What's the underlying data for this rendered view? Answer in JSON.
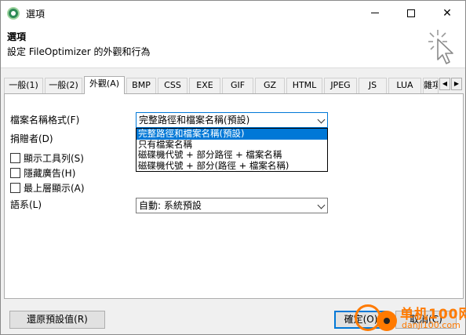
{
  "window": {
    "title": "選項",
    "icon": "fileoptimizer-app-icon",
    "controls": [
      "minimize-icon",
      "maximize-icon",
      "close-icon"
    ],
    "close_glyph": "✕"
  },
  "header": {
    "title": "選項",
    "description": "設定 FileOptimizer 的外觀和行為",
    "icon": "cursor-click-icon"
  },
  "tabs": [
    {
      "label": "一般(1)",
      "active": false
    },
    {
      "label": "一般(2)",
      "active": false
    },
    {
      "label": "外觀(A)",
      "active": true
    },
    {
      "label": "BMP",
      "active": false
    },
    {
      "label": "CSS",
      "active": false
    },
    {
      "label": "EXE",
      "active": false
    },
    {
      "label": "GIF",
      "active": false
    },
    {
      "label": "GZ",
      "active": false
    },
    {
      "label": "HTML",
      "active": false
    },
    {
      "label": "JPEG",
      "active": false
    },
    {
      "label": "JS",
      "active": false
    },
    {
      "label": "LUA",
      "active": false
    },
    {
      "label": "雜項",
      "active": false
    }
  ],
  "tab_scroll": {
    "left": "◀",
    "right": "▶"
  },
  "appearance": {
    "filename_format_label": "檔案名稱格式(F)",
    "filename_format_value": "完整路徑和檔案名稱(預設)",
    "filename_format_options": [
      "完整路徑和檔案名稱(預設)",
      "只有檔案名稱",
      "磁碟機代號 + 部分路徑 + 檔案名稱",
      "磁碟機代號 + 部分(路徑 + 檔案名稱)"
    ],
    "donator_label": "捐贈者(D)",
    "checkboxes": [
      {
        "label": "顯示工具列(S)",
        "checked": false
      },
      {
        "label": "隱藏廣告(H)",
        "checked": false
      },
      {
        "label": "最上層顯示(A)",
        "checked": false
      }
    ],
    "language_label": "語系(L)",
    "language_value": "自動: 系統預設"
  },
  "buttons": {
    "restore_defaults": "還原預設值(R)",
    "ok": "確定(O)",
    "cancel": "取消(C)"
  },
  "watermark": {
    "line1": "单机100网",
    "line2": "danji100.com",
    "color": "#ff7a00"
  },
  "colors": {
    "selection": "#0078d7",
    "focus_border": "#0078d7"
  }
}
